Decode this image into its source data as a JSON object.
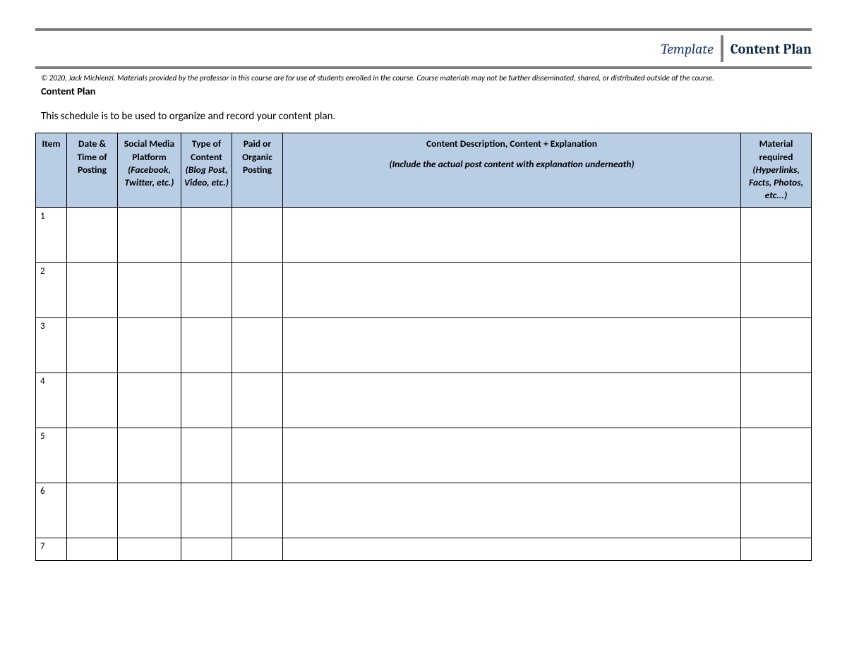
{
  "header": {
    "template_label": "Template",
    "title": "Content Plan"
  },
  "copyright": "© 2020, Jack Michienzi.  Materials provided by the professor in this course are for use of students enrolled in the course.  Course materials may not be further disseminated, shared, or distributed outside of the course.",
  "section_title": "Content Plan",
  "intro": "This schedule is to be used to organize and record your content plan.",
  "columns": {
    "item": {
      "main": "Item"
    },
    "date": {
      "main": "Date & Time of Posting"
    },
    "platform": {
      "main": "Social Media Platform",
      "sub": "(Facebook, Twitter, etc.)"
    },
    "type": {
      "main": "Type of Content",
      "sub": "(Blog Post, Video, etc.)"
    },
    "paid": {
      "main": "Paid or Organic Posting"
    },
    "description": {
      "main": "Content Description, Content + Explanation",
      "sub": "(Include the actual post content with explanation underneath)"
    },
    "material": {
      "main": "Material required",
      "sub": "(Hyperlinks, Facts, Photos, etc...)"
    }
  },
  "rows": [
    {
      "item": "1",
      "date": "",
      "platform": "",
      "type": "",
      "paid": "",
      "description": "",
      "material": ""
    },
    {
      "item": "2",
      "date": "",
      "platform": "",
      "type": "",
      "paid": "",
      "description": "",
      "material": ""
    },
    {
      "item": "3",
      "date": "",
      "platform": "",
      "type": "",
      "paid": "",
      "description": "",
      "material": ""
    },
    {
      "item": "4",
      "date": "",
      "platform": "",
      "type": "",
      "paid": "",
      "description": "",
      "material": ""
    },
    {
      "item": "5",
      "date": "",
      "platform": "",
      "type": "",
      "paid": "",
      "description": "",
      "material": ""
    },
    {
      "item": "6",
      "date": "",
      "platform": "",
      "type": "",
      "paid": "",
      "description": "",
      "material": ""
    },
    {
      "item": "7",
      "date": "",
      "platform": "",
      "type": "",
      "paid": "",
      "description": "",
      "material": ""
    }
  ]
}
